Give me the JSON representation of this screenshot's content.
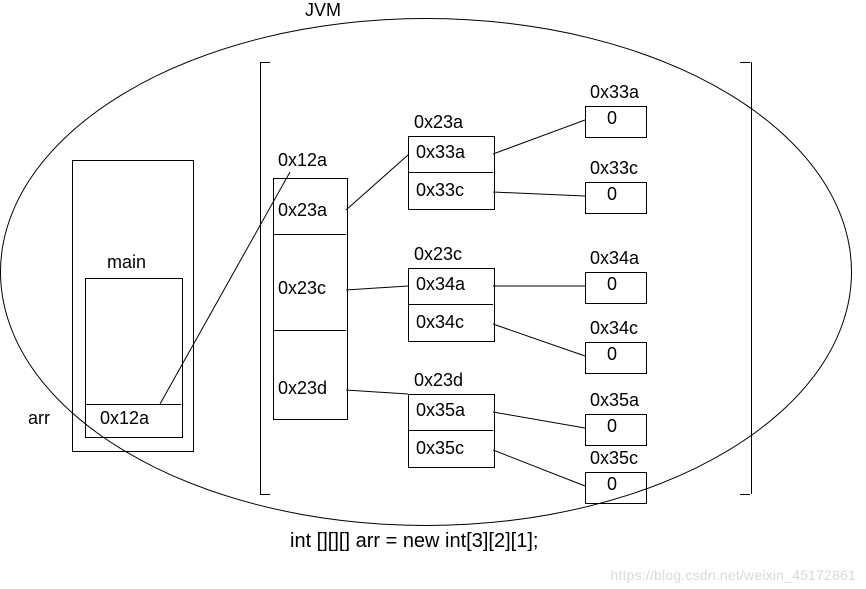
{
  "title": "JVM",
  "stack": {
    "frame_label": "main",
    "var_label": "arr",
    "var_value": "0x12a"
  },
  "heap": {
    "outer_label": "0x12a",
    "outer_cells": [
      "0x23a",
      "0x23c",
      "0x23d"
    ],
    "mid_groups": [
      {
        "label": "0x23a",
        "cells": [
          "0x33a",
          "0x33c"
        ]
      },
      {
        "label": "0x23c",
        "cells": [
          "0x34a",
          "0x34c"
        ]
      },
      {
        "label": "0x23d",
        "cells": [
          "0x35a",
          "0x35c"
        ]
      }
    ],
    "leaf_groups": [
      {
        "label": "0x33a",
        "value": "0"
      },
      {
        "label": "0x33c",
        "value": "0"
      },
      {
        "label": "0x34a",
        "value": "0"
      },
      {
        "label": "0x34c",
        "value": "0"
      },
      {
        "label": "0x35a",
        "value": "0"
      },
      {
        "label": "0x35c",
        "value": "0"
      }
    ]
  },
  "code": "int [][][]  arr = new int[3][2][1];",
  "watermark": "https://blog.csdn.net/weixin_45172861"
}
